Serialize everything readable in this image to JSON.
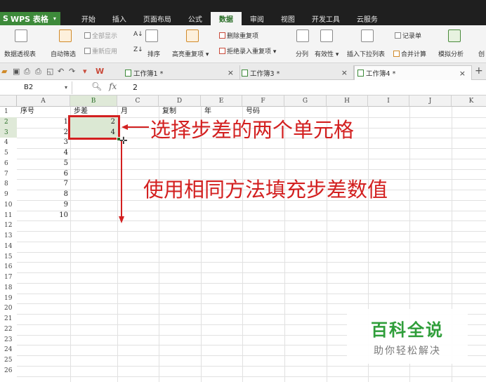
{
  "app": {
    "name": "WPS 表格",
    "logo": "S"
  },
  "menu_tabs": [
    "开始",
    "插入",
    "页面布局",
    "公式",
    "数据",
    "审阅",
    "视图",
    "开发工具",
    "云服务"
  ],
  "active_menu": "数据",
  "ribbon": {
    "pivot": "数据透视表",
    "autofilter": "自动筛选",
    "show_all": "全部显示",
    "reapply": "重新应用",
    "sort": "排序",
    "highlight_dup": "高亮重复项",
    "delete_dup": "删除重复项",
    "reject_dup": "拒绝录入重复项",
    "split": "分列",
    "validity": "有效性",
    "insert_dropdown": "插入下拉列表",
    "record": "记录单",
    "merge_calc": "合并计算",
    "simulate": "模拟分析",
    "create": "创"
  },
  "doc_tabs": [
    "工作簿1 *",
    "工作簿3 *",
    "工作簿4 *"
  ],
  "formula_bar": {
    "cell_ref": "B2",
    "fx": "fx",
    "value": "2"
  },
  "columns": [
    "A",
    "B",
    "C",
    "D",
    "E",
    "F",
    "G",
    "H",
    "I",
    "J",
    "K"
  ],
  "rows": [
    "1",
    "2",
    "3",
    "4",
    "5",
    "6",
    "7",
    "8",
    "9",
    "10",
    "11",
    "12",
    "13",
    "14",
    "15",
    "16",
    "17",
    "18",
    "19",
    "20",
    "21",
    "22",
    "23",
    "24",
    "25",
    "26"
  ],
  "header_cells": {
    "A1": "序号",
    "B1": "步差",
    "C1": "月",
    "D1": "复制",
    "E1": "年",
    "F1": "号码"
  },
  "col_a_values": [
    "1",
    "2",
    "3",
    "4",
    "5",
    "6",
    "7",
    "8",
    "9",
    "10"
  ],
  "col_b_values": [
    "2",
    "4"
  ],
  "annotations": {
    "line1": "选择步差的两个单元格",
    "line2": "使用相同方法填充步差数值"
  },
  "watermark": {
    "title": "百科全说",
    "subtitle": "助你轻松解决"
  },
  "colors": {
    "accent": "#3d8a3a",
    "annotation": "#d32020",
    "watermark": "#2f9e3a"
  }
}
